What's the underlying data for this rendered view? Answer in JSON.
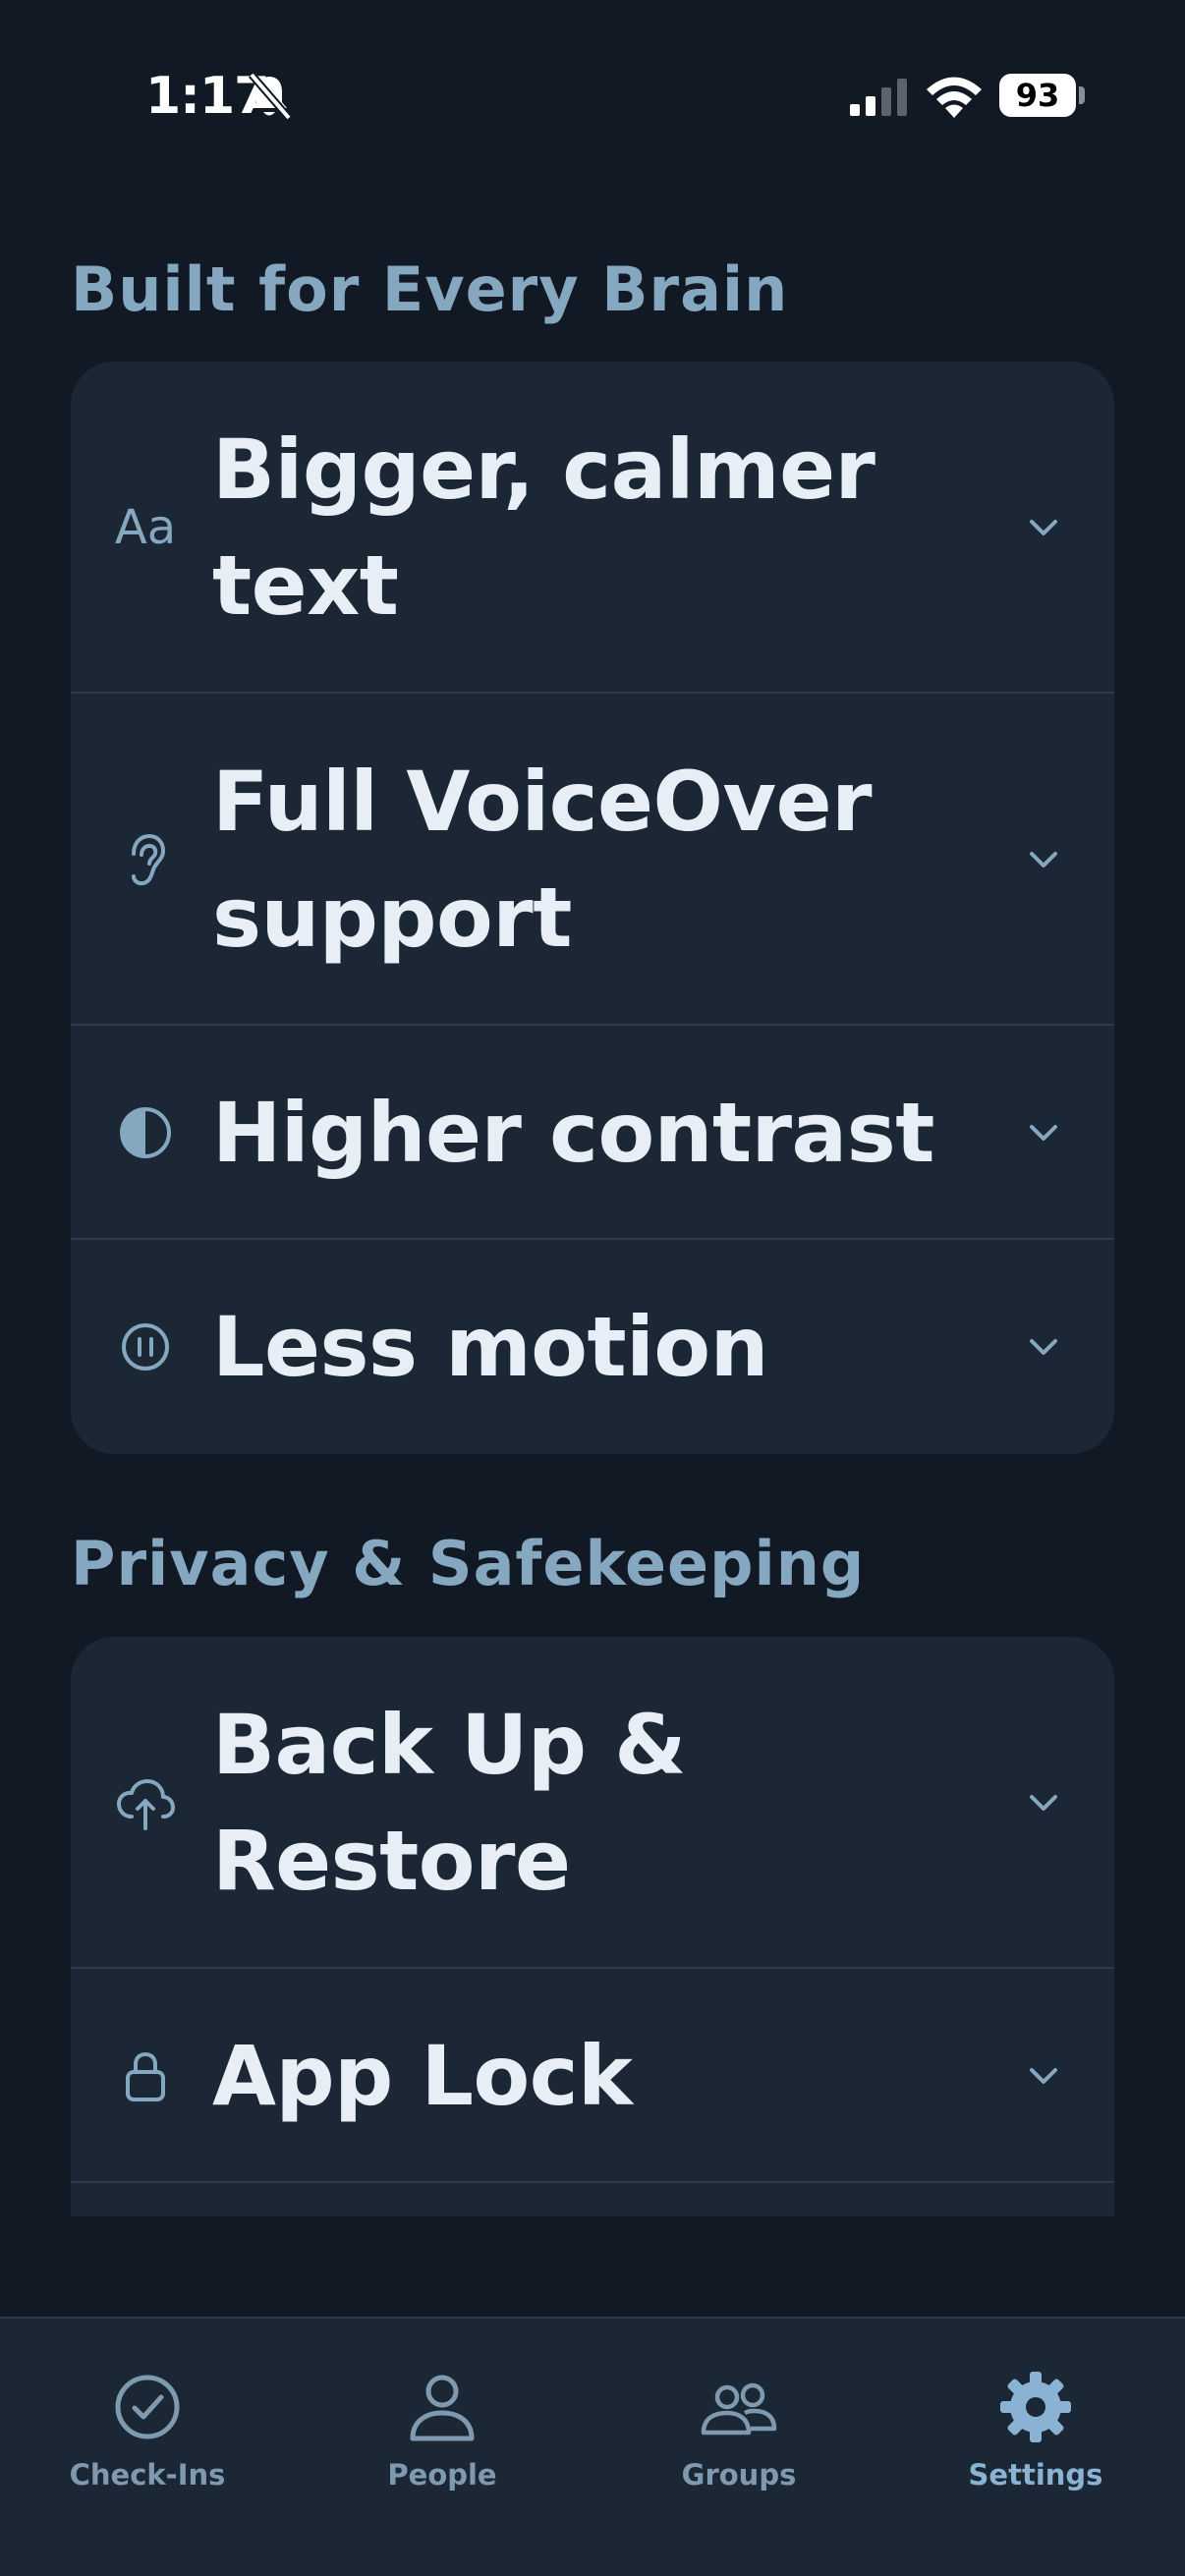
{
  "status_bar": {
    "time": "1:17",
    "battery": "93"
  },
  "sections": [
    {
      "title": "Built for Every Brain",
      "rows": [
        {
          "label": "Bigger, calmer text",
          "icon": "text-size-icon"
        },
        {
          "label": "Full VoiceOver support",
          "icon": "ear-icon"
        },
        {
          "label": "Higher contrast",
          "icon": "contrast-icon"
        },
        {
          "label": "Less motion",
          "icon": "pause-icon"
        }
      ]
    },
    {
      "title": "Privacy & Safekeeping",
      "rows": [
        {
          "label": "Back Up & Restore",
          "icon": "cloud-upload-icon"
        },
        {
          "label": "App Lock",
          "icon": "lock-icon"
        }
      ]
    }
  ],
  "text_size_glyph": "Aa",
  "tab_bar": {
    "tabs": [
      {
        "label": "Check-Ins",
        "icon": "checkmark-circle-icon"
      },
      {
        "label": "People",
        "icon": "person-icon"
      },
      {
        "label": "Groups",
        "icon": "group-icon"
      },
      {
        "label": "Settings",
        "icon": "gear-icon"
      }
    ],
    "active": "Settings"
  },
  "colors": {
    "background": "#111a24",
    "card": "#1c2735",
    "heading": "#86a7c0",
    "text": "#e8eef5",
    "accent": "#8ab2d3"
  }
}
